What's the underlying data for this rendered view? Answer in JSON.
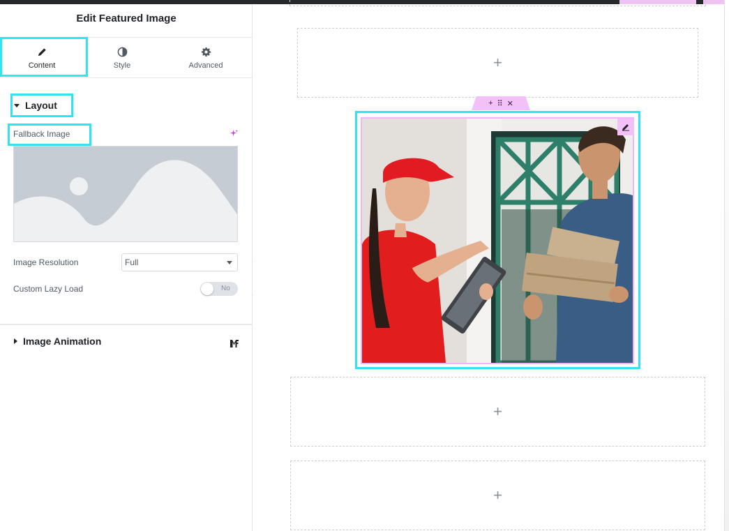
{
  "panel": {
    "title": "Edit Featured Image",
    "tabs": [
      {
        "label": "Content",
        "icon": "pencil-icon"
      },
      {
        "label": "Style",
        "icon": "half-circle-icon"
      },
      {
        "label": "Advanced",
        "icon": "gear-icon"
      }
    ],
    "active_tab": "Content",
    "layout_section": {
      "title": "Layout",
      "fallback_image_label": "Fallback Image",
      "image_resolution_label": "Image Resolution",
      "image_resolution_value": "Full",
      "custom_lazy_load_label": "Custom Lazy Load",
      "custom_lazy_load_value": "No"
    },
    "animation_section": {
      "title": "Image Animation"
    }
  },
  "canvas": {
    "add_placeholder": "+",
    "widget_toolbar": {
      "add": "+",
      "drag": "⠿",
      "remove": "✕"
    }
  },
  "colors": {
    "highlight": "#2fe5f0",
    "widget_accent": "#f3c1f8",
    "ai_accent": "#c93ee0"
  }
}
